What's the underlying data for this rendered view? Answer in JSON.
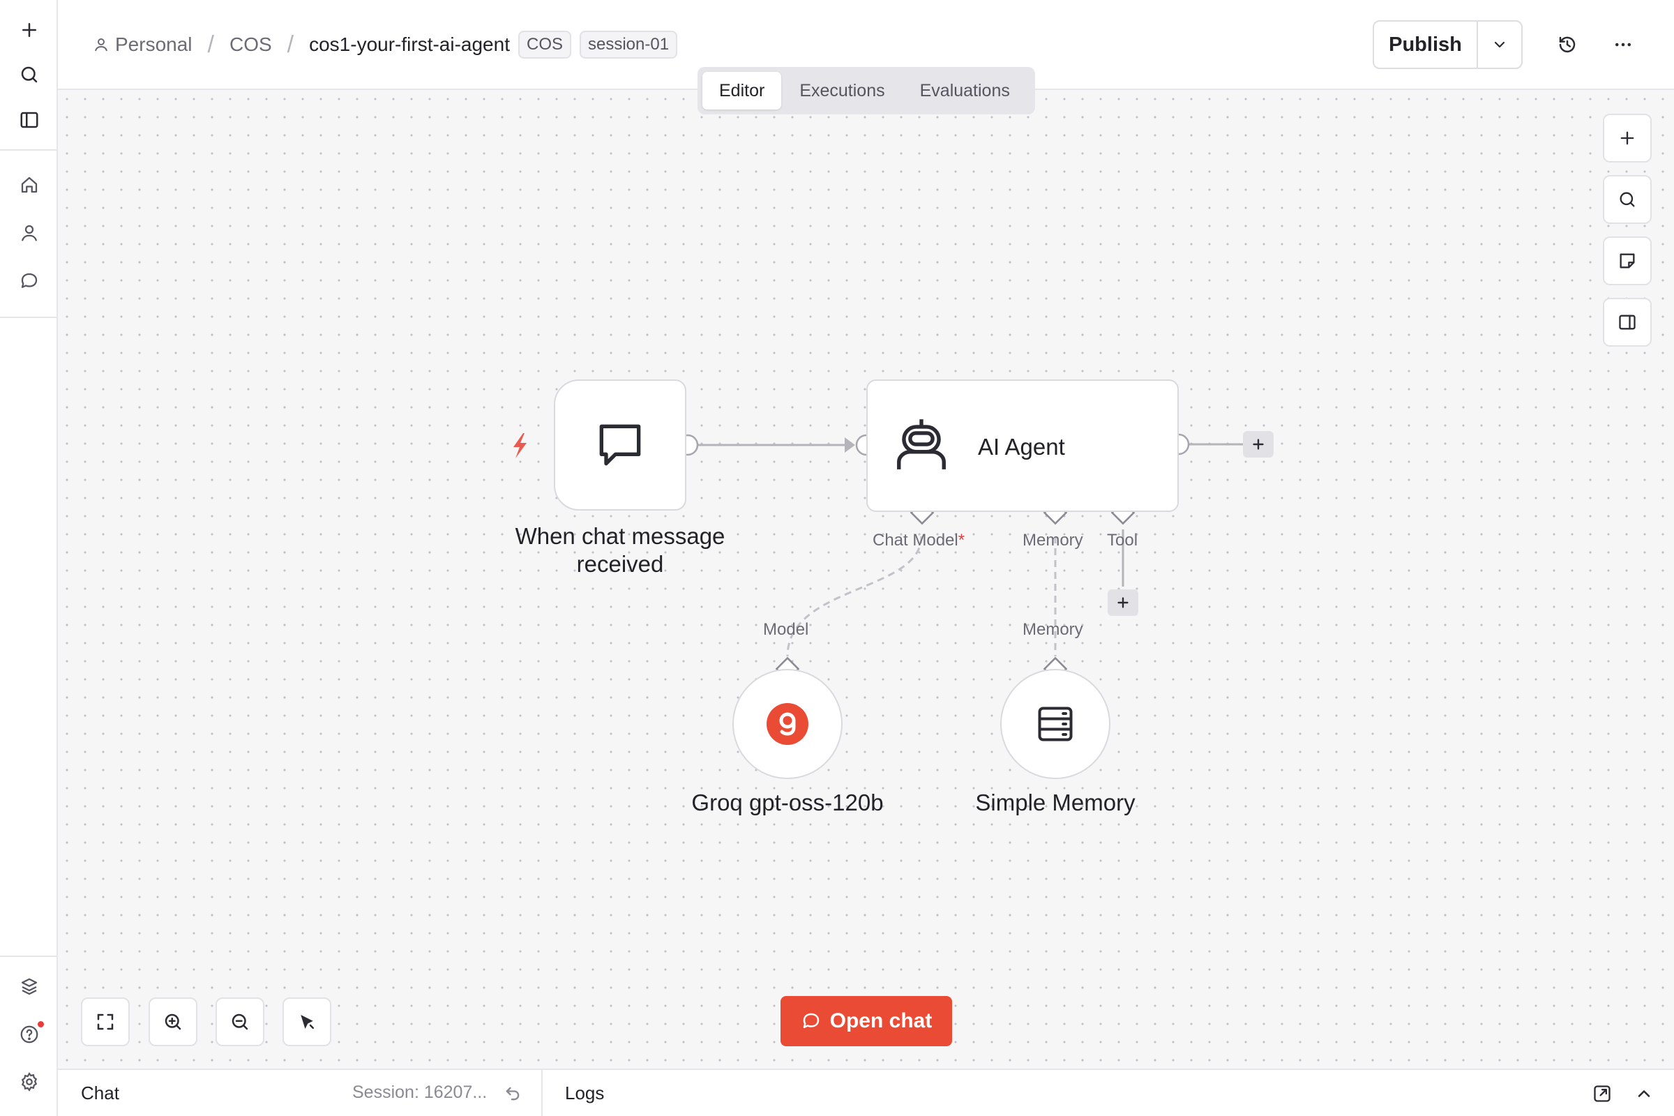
{
  "breadcrumb": {
    "owner": "Personal",
    "project": "COS",
    "workflow": "cos1-your-first-ai-agent",
    "tags": [
      "COS",
      "session-01"
    ]
  },
  "header": {
    "publish_label": "Publish"
  },
  "tabs": [
    {
      "label": "Editor",
      "active": true
    },
    {
      "label": "Executions",
      "active": false
    },
    {
      "label": "Evaluations",
      "active": false
    }
  ],
  "nodes": {
    "trigger": {
      "label": "When chat message received",
      "line1": "When chat message",
      "line2": "received",
      "icon": "chat-bubble-icon"
    },
    "agent": {
      "label": "AI Agent",
      "icon": "robot-icon",
      "ports": {
        "chat_model": "Chat Model",
        "chat_model_required": "*",
        "memory": "Memory",
        "tool": "Tool"
      }
    },
    "model": {
      "label": "Groq gpt-oss-120b",
      "port": "Model",
      "icon": "groq-icon"
    },
    "memory": {
      "label": "Simple Memory",
      "port": "Memory",
      "icon": "database-icon"
    }
  },
  "actions": {
    "open_chat": "Open chat"
  },
  "bottom": {
    "chat_label": "Chat",
    "session": "Session: 16207...",
    "logs_label": "Logs"
  },
  "colors": {
    "accent": "#ea4b35",
    "trigger_bolt": "#ea5a4e",
    "canvas": "#f6f6f7",
    "node_border": "#d9d9de",
    "edge": "#b4b4ba"
  }
}
